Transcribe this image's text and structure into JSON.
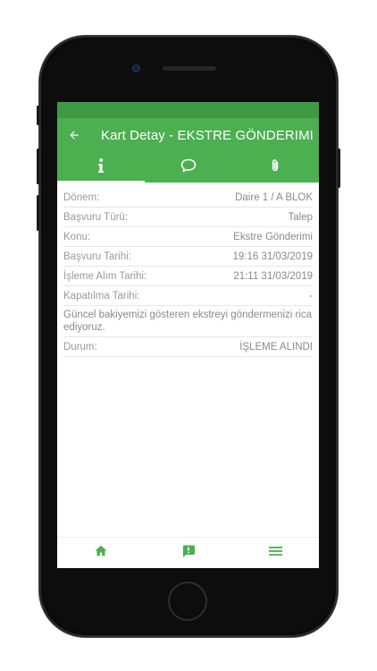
{
  "app": {
    "title": "Kart Detay - EKSTRE GÖNDERIMI",
    "accent_color": "#4caf50"
  },
  "tabs": [
    {
      "icon": "info-icon",
      "active": true
    },
    {
      "icon": "comment-icon",
      "active": false
    },
    {
      "icon": "paperclip-icon",
      "active": false
    }
  ],
  "details": {
    "donem": {
      "label": "Dönem:",
      "value": "Daire 1 / A BLOK"
    },
    "basvuru_turu": {
      "label": "Başvuru Türü:",
      "value": "Talep"
    },
    "konu": {
      "label": "Konu:",
      "value": "Ekstre Gönderimi"
    },
    "basvuru_tarihi": {
      "label": "Başvuru Tarihi:",
      "value": "19:16 31/03/2019"
    },
    "isleme_alim_tarihi": {
      "label": "İşleme Alım Tarihi:",
      "value": "21:11 31/03/2019"
    },
    "kapatilma_tarihi": {
      "label": "Kapatılma Tarihi:",
      "value": "-"
    },
    "aciklama": "Güncel bakiyemizi gösteren ekstreyi göndermenizi rica ediyoruz.",
    "durum": {
      "label": "Durum:",
      "value": "İŞLEME ALINDI"
    }
  },
  "bottom_nav": [
    {
      "icon": "home-icon"
    },
    {
      "icon": "feedback-icon"
    },
    {
      "icon": "menu-icon"
    }
  ]
}
